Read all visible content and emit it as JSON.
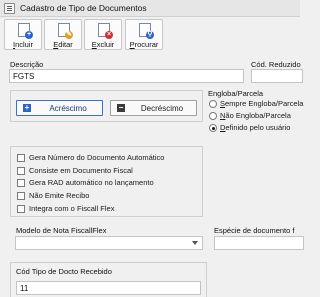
{
  "window": {
    "title": "Cadastro de Tipo de Documentos"
  },
  "toolbar": {
    "buttons": [
      {
        "label": "Incluir",
        "icon": "new-document-icon",
        "color": "#2d64c9"
      },
      {
        "label": "Editar",
        "icon": "edit-document-icon",
        "color": "#e0a020"
      },
      {
        "label": "Excluir",
        "icon": "delete-document-icon",
        "color": "#d03030"
      },
      {
        "label": "Procurar",
        "icon": "search-document-icon",
        "color": "#2d64c9"
      }
    ]
  },
  "form": {
    "descricao": {
      "label": "Descrição",
      "value": "FGTS"
    },
    "cod_reduzido": {
      "label": "Cód. Reduzido",
      "value": ""
    },
    "acrescimo_button": {
      "label": "Acréscimo",
      "symbol": "+"
    },
    "decrescimo_button": {
      "label": "Decréscimo",
      "symbol": "−"
    },
    "engloba": {
      "title": "Engloba/Parcela",
      "options": [
        {
          "label": "Sempre Engloba/Parcela",
          "checked": false
        },
        {
          "label": "Não Engloba/Parcela",
          "checked": false
        },
        {
          "label": "Definido pelo usuário",
          "checked": true
        }
      ]
    },
    "checkboxes": [
      {
        "label": "Gera Número do Documento Automático",
        "checked": false
      },
      {
        "label": "Consiste em Documento Fiscal",
        "checked": false
      },
      {
        "label": "Gera RAD automático no lançamento",
        "checked": false
      },
      {
        "label": "Não Emite Recibo",
        "checked": false
      },
      {
        "label": "Integra com o Fiscall Flex",
        "checked": false
      }
    ],
    "modelo_nota": {
      "label": "Modelo de Nota FiscallFlex",
      "value": ""
    },
    "especie": {
      "label": "Espécie de documento f",
      "value": ""
    },
    "cod_tipo": {
      "label": "Cód Tipo de Docto Recebido",
      "value": "11"
    }
  },
  "colors": {
    "accent": "#2d64c9",
    "background": "#f0f0f0"
  }
}
